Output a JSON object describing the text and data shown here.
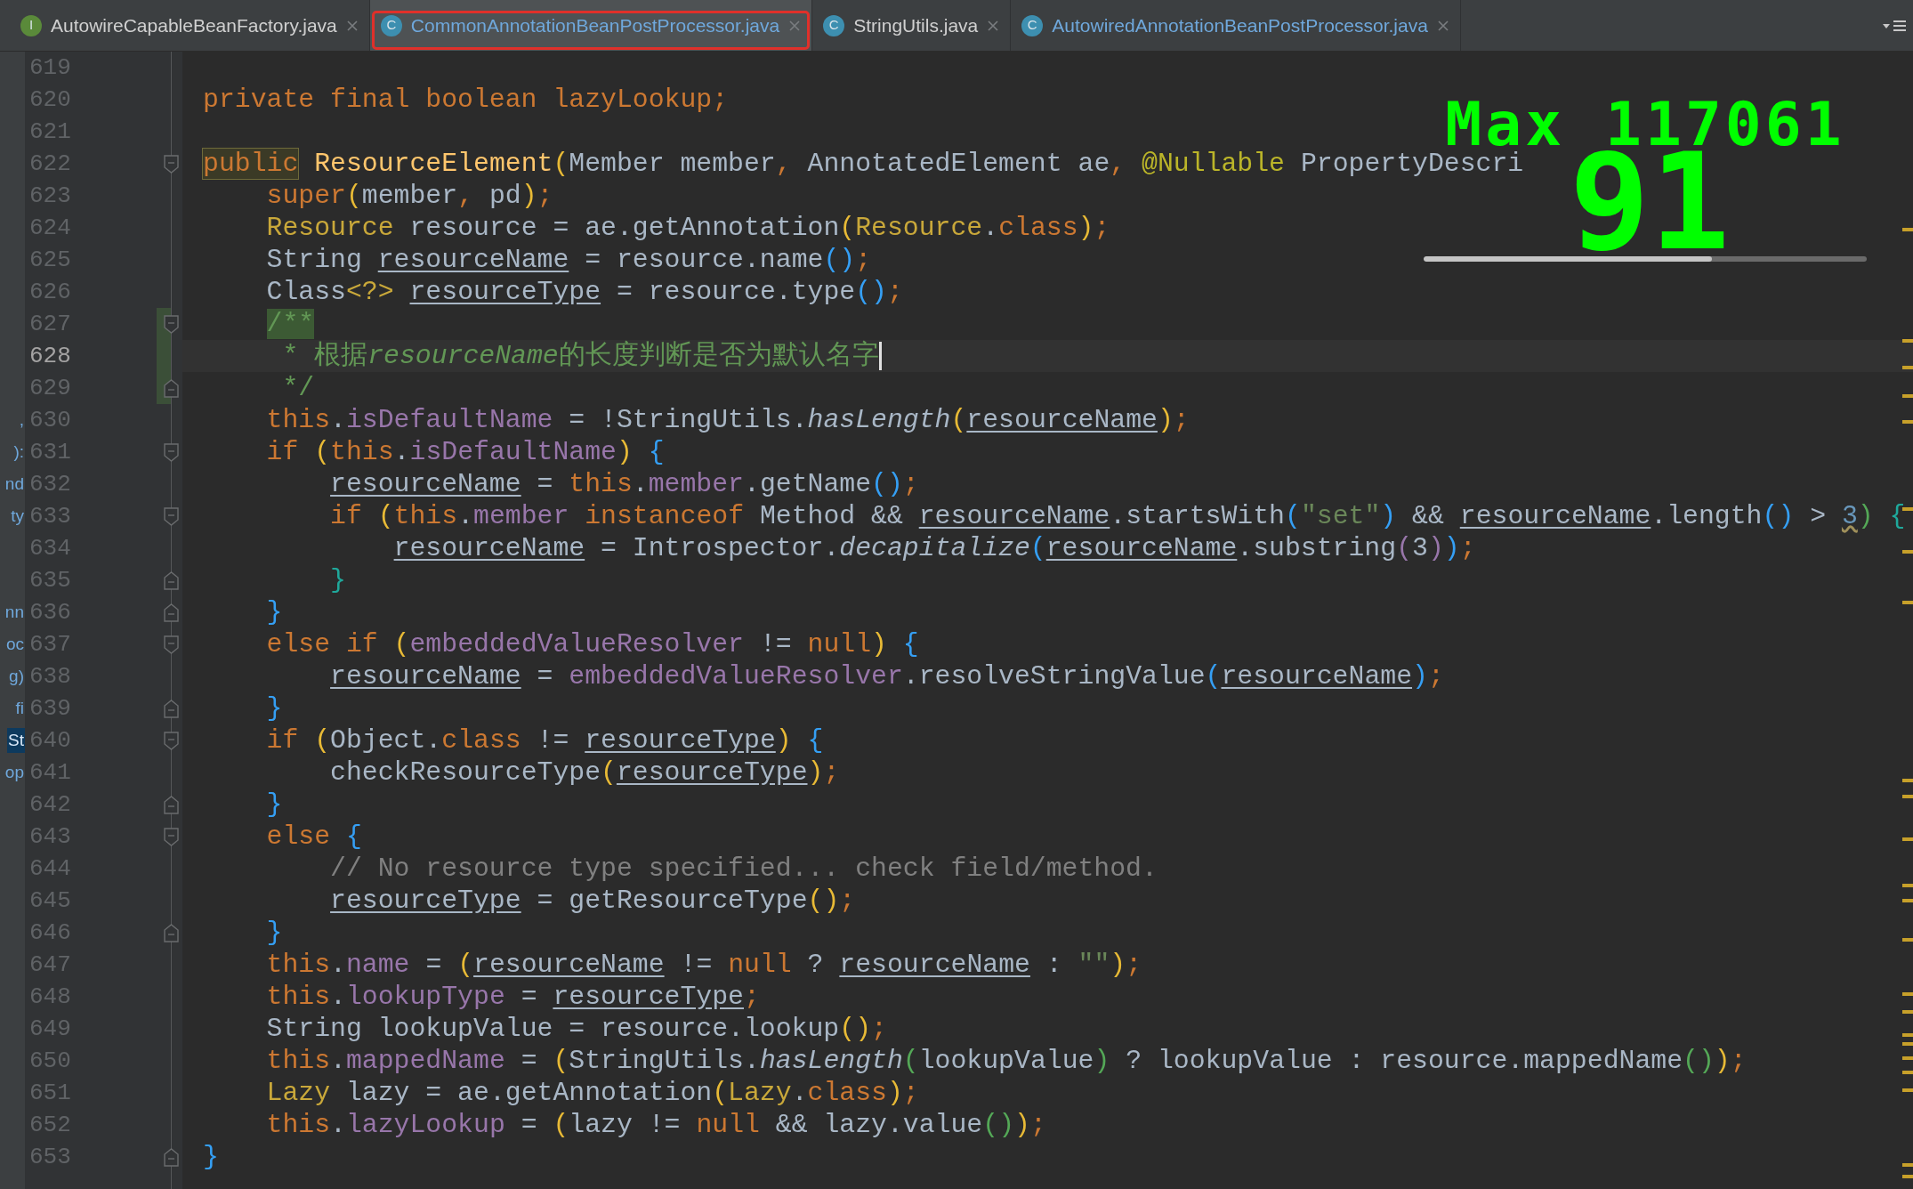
{
  "tabs": [
    {
      "icon_letter": "I",
      "color": "#5a8a3a",
      "label": "AutowireCapableBeanFactory.java",
      "selected": false,
      "modified": false,
      "outlined": false
    },
    {
      "icon_letter": "C",
      "color": "#3d8fb0",
      "label": "CommonAnnotationBeanPostProcessor.java",
      "selected": true,
      "modified": true,
      "outlined": true
    },
    {
      "icon_letter": "C",
      "color": "#3d8fb0",
      "label": "StringUtils.java",
      "selected": false,
      "modified": false,
      "outlined": false
    },
    {
      "icon_letter": "C",
      "color": "#3d8fb0",
      "label": "AutowiredAnnotationBeanPostProcessor.java",
      "selected": false,
      "modified": true,
      "outlined": false
    }
  ],
  "overlay": {
    "title": "Max 117061",
    "value": "91",
    "level": 0.65
  },
  "lines": [
    {
      "number": "619"
    },
    {
      "number": "620",
      "tokens": [
        {
          "kind": "kw",
          "text": "private final boolean lazyLookup;"
        }
      ]
    },
    {
      "number": "621"
    },
    {
      "number": "622",
      "fold": {
        "kind": "open"
      },
      "tokens": [
        {
          "kind": "kwmatch",
          "text": "public"
        },
        {
          "kind": "method",
          "text": " ResourceElement"
        },
        {
          "kind": "b1",
          "text": "("
        },
        {
          "kind": "plain",
          "text": "Member member"
        },
        {
          "kind": "kw",
          "text": ", "
        },
        {
          "kind": "plain",
          "text": "AnnotatedElement ae"
        },
        {
          "kind": "kw",
          "text": ", "
        },
        {
          "kind": "ann",
          "text": "@Nullable"
        },
        {
          "kind": "plain",
          "text": " PropertyDescri"
        }
      ]
    },
    {
      "number": "623",
      "tokens": [
        {
          "kind": "kw",
          "text": "    super"
        },
        {
          "kind": "b1",
          "text": "("
        },
        {
          "kind": "plain",
          "text": "member"
        },
        {
          "kind": "kw",
          "text": ", "
        },
        {
          "kind": "plain",
          "text": "pd"
        },
        {
          "kind": "b1",
          "text": ")"
        },
        {
          "kind": "kw",
          "text": ";"
        }
      ]
    },
    {
      "number": "624",
      "tokens": [
        {
          "kind": "type",
          "text": "    Resource"
        },
        {
          "kind": "plain",
          "text": " resource = ae.getAnnotation"
        },
        {
          "kind": "b1",
          "text": "("
        },
        {
          "kind": "type",
          "text": "Resource"
        },
        {
          "kind": "plain",
          "text": "."
        },
        {
          "kind": "kw",
          "text": "class"
        },
        {
          "kind": "b1",
          "text": ")"
        },
        {
          "kind": "kw",
          "text": ";"
        }
      ]
    },
    {
      "number": "625",
      "tokens": [
        {
          "kind": "plain",
          "text": "    String "
        },
        {
          "kind": "var",
          "text": "resourceName"
        },
        {
          "kind": "plain",
          "text": " = resource.name"
        },
        {
          "kind": "b3",
          "text": "()"
        },
        {
          "kind": "kw",
          "text": ";"
        }
      ]
    },
    {
      "number": "626",
      "tokens": [
        {
          "kind": "plain",
          "text": "    Class"
        },
        {
          "kind": "type",
          "text": "<?>"
        },
        {
          "kind": "var",
          "text": " resourceType"
        },
        {
          "kind": "plain",
          "text": " = resource.type"
        },
        {
          "kind": "b3",
          "text": "()"
        },
        {
          "kind": "kw",
          "text": ";"
        }
      ]
    },
    {
      "number": "627",
      "fold": {
        "kind": "open"
      },
      "changed": true,
      "tokens": [
        {
          "kind": "docmatch",
          "text": "    /**"
        }
      ]
    },
    {
      "number": "628",
      "changed": true,
      "current": true,
      "caret": true,
      "tokens": [
        {
          "kind": "doc",
          "text": "     * 根据"
        },
        {
          "kind": "docvar",
          "text": "resourceName"
        },
        {
          "kind": "doc",
          "text": "的长度判断是否为默认名字"
        }
      ]
    },
    {
      "number": "629",
      "fold": {
        "kind": "close"
      },
      "changed": true,
      "tokens": [
        {
          "kind": "doc",
          "text": "     */"
        }
      ]
    },
    {
      "number": "630",
      "side_text": ",",
      "side_selected": false,
      "tokens": [
        {
          "kind": "kw",
          "text": "    this"
        },
        {
          "kind": "plain",
          "text": "."
        },
        {
          "kind": "field",
          "text": "isDefaultName"
        },
        {
          "kind": "plain",
          "text": " = !StringUtils."
        },
        {
          "kind": "static",
          "text": "hasLength"
        },
        {
          "kind": "b1",
          "text": "("
        },
        {
          "kind": "var",
          "text": "resourceName"
        },
        {
          "kind": "b1",
          "text": ")"
        },
        {
          "kind": "kw",
          "text": ";"
        }
      ]
    },
    {
      "number": "631",
      "side_text": "):",
      "side_selected": false,
      "fold": {
        "kind": "open"
      },
      "tokens": [
        {
          "kind": "kw",
          "text": "    if "
        },
        {
          "kind": "b1",
          "text": "("
        },
        {
          "kind": "kw",
          "text": "this"
        },
        {
          "kind": "plain",
          "text": "."
        },
        {
          "kind": "field",
          "text": "isDefaultName"
        },
        {
          "kind": "b1",
          "text": ")"
        },
        {
          "kind": "b3",
          "text": " {"
        }
      ]
    },
    {
      "number": "632",
      "side_text": "nd",
      "side_selected": false,
      "tokens": [
        {
          "kind": "var",
          "text": "        resourceName"
        },
        {
          "kind": "plain",
          "text": " = "
        },
        {
          "kind": "kw",
          "text": "this"
        },
        {
          "kind": "plain",
          "text": "."
        },
        {
          "kind": "field",
          "text": "member"
        },
        {
          "kind": "plain",
          "text": ".getName"
        },
        {
          "kind": "b3",
          "text": "()"
        },
        {
          "kind": "kw",
          "text": ";"
        }
      ]
    },
    {
      "number": "633",
      "side_text": "ty",
      "side_selected": false,
      "fold": {
        "kind": "open"
      },
      "tokens": [
        {
          "kind": "kw",
          "text": "        if "
        },
        {
          "kind": "b1",
          "text": "("
        },
        {
          "kind": "kw",
          "text": "this"
        },
        {
          "kind": "plain",
          "text": "."
        },
        {
          "kind": "field",
          "text": "member"
        },
        {
          "kind": "kw",
          "text": " instanceof "
        },
        {
          "kind": "plain",
          "text": "Method && "
        },
        {
          "kind": "var",
          "text": "resourceName"
        },
        {
          "kind": "plain",
          "text": ".startsWith"
        },
        {
          "kind": "b3",
          "text": "("
        },
        {
          "kind": "str",
          "text": "\"set\""
        },
        {
          "kind": "b3",
          "text": ")"
        },
        {
          "kind": "plain",
          "text": " && "
        },
        {
          "kind": "var",
          "text": "resourceName"
        },
        {
          "kind": "plain",
          "text": ".length"
        },
        {
          "kind": "b3",
          "text": "()"
        },
        {
          "kind": "plain",
          "text": " > "
        },
        {
          "kind": "num",
          "text": "3"
        },
        {
          "kind": "b2",
          "text": ")"
        },
        {
          "kind": "b4",
          "text": " {"
        }
      ]
    },
    {
      "number": "634",
      "tokens": [
        {
          "kind": "var",
          "text": "            resourceName"
        },
        {
          "kind": "plain",
          "text": " = Introspector."
        },
        {
          "kind": "static",
          "text": "decapitalize"
        },
        {
          "kind": "b3",
          "text": "("
        },
        {
          "kind": "var",
          "text": "resourceName"
        },
        {
          "kind": "plain",
          "text": ".substring"
        },
        {
          "kind": "field",
          "text": "("
        },
        {
          "kind": "plain",
          "text": "3"
        },
        {
          "kind": "field",
          "text": ")"
        },
        {
          "kind": "b3",
          "text": ")"
        },
        {
          "kind": "kw",
          "text": ";"
        }
      ]
    },
    {
      "number": "635",
      "fold": {
        "kind": "close"
      },
      "tokens": [
        {
          "kind": "b4",
          "text": "        }"
        }
      ]
    },
    {
      "number": "636",
      "side_text": "nn",
      "side_selected": false,
      "fold": {
        "kind": "close"
      },
      "tokens": [
        {
          "kind": "b3",
          "text": "    }"
        }
      ]
    },
    {
      "number": "637",
      "side_text": "oc",
      "side_selected": false,
      "fold": {
        "kind": "open"
      },
      "tokens": [
        {
          "kind": "kw",
          "text": "    else if "
        },
        {
          "kind": "b1",
          "text": "("
        },
        {
          "kind": "field",
          "text": "embeddedValueResolver"
        },
        {
          "kind": "plain",
          "text": " != "
        },
        {
          "kind": "kw",
          "text": "null"
        },
        {
          "kind": "b1",
          "text": ")"
        },
        {
          "kind": "b3",
          "text": " {"
        }
      ]
    },
    {
      "number": "638",
      "side_text": "g)",
      "side_selected": false,
      "tokens": [
        {
          "kind": "var",
          "text": "        resourceName"
        },
        {
          "kind": "plain",
          "text": " = "
        },
        {
          "kind": "field",
          "text": "embeddedValueResolver"
        },
        {
          "kind": "plain",
          "text": ".resolveStringValue"
        },
        {
          "kind": "b3",
          "text": "("
        },
        {
          "kind": "var",
          "text": "resourceName"
        },
        {
          "kind": "b3",
          "text": ")"
        },
        {
          "kind": "kw",
          "text": ";"
        }
      ]
    },
    {
      "number": "639",
      "side_text": "fi",
      "side_selected": false,
      "fold": {
        "kind": "close"
      },
      "tokens": [
        {
          "kind": "b3",
          "text": "    }"
        }
      ]
    },
    {
      "number": "640",
      "side_text": "St",
      "side_selected": true,
      "fold": {
        "kind": "open"
      },
      "tokens": [
        {
          "kind": "kw",
          "text": "    if "
        },
        {
          "kind": "b1",
          "text": "("
        },
        {
          "kind": "plain",
          "text": "Object."
        },
        {
          "kind": "kw",
          "text": "class"
        },
        {
          "kind": "plain",
          "text": " != "
        },
        {
          "kind": "var",
          "text": "resourceType"
        },
        {
          "kind": "b1",
          "text": ")"
        },
        {
          "kind": "b3",
          "text": " {"
        }
      ]
    },
    {
      "number": "641",
      "side_text": "op",
      "side_selected": false,
      "tokens": [
        {
          "kind": "plain",
          "text": "        checkResourceType"
        },
        {
          "kind": "b1",
          "text": "("
        },
        {
          "kind": "var",
          "text": "resourceType"
        },
        {
          "kind": "b1",
          "text": ")"
        },
        {
          "kind": "kw",
          "text": ";"
        }
      ]
    },
    {
      "number": "642",
      "fold": {
        "kind": "close"
      },
      "tokens": [
        {
          "kind": "b3",
          "text": "    }"
        }
      ]
    },
    {
      "number": "643",
      "fold": {
        "kind": "open"
      },
      "tokens": [
        {
          "kind": "kw",
          "text": "    else"
        },
        {
          "kind": "b3",
          "text": " {"
        }
      ]
    },
    {
      "number": "644",
      "tokens": [
        {
          "kind": "cmt",
          "text": "        // No resource type specified... check field/method."
        }
      ]
    },
    {
      "number": "645",
      "tokens": [
        {
          "kind": "var",
          "text": "        resourceType"
        },
        {
          "kind": "plain",
          "text": " = getResourceType"
        },
        {
          "kind": "b1",
          "text": "()"
        },
        {
          "kind": "kw",
          "text": ";"
        }
      ]
    },
    {
      "number": "646",
      "fold": {
        "kind": "close"
      },
      "tokens": [
        {
          "kind": "b3",
          "text": "    }"
        }
      ]
    },
    {
      "number": "647",
      "tokens": [
        {
          "kind": "kw",
          "text": "    this"
        },
        {
          "kind": "plain",
          "text": "."
        },
        {
          "kind": "field",
          "text": "name"
        },
        {
          "kind": "plain",
          "text": " = "
        },
        {
          "kind": "b1",
          "text": "("
        },
        {
          "kind": "var",
          "text": "resourceName"
        },
        {
          "kind": "plain",
          "text": " != "
        },
        {
          "kind": "kw",
          "text": "null"
        },
        {
          "kind": "plain",
          "text": " ? "
        },
        {
          "kind": "var",
          "text": "resourceName"
        },
        {
          "kind": "plain",
          "text": " : "
        },
        {
          "kind": "str",
          "text": "\"\""
        },
        {
          "kind": "b1",
          "text": ")"
        },
        {
          "kind": "kw",
          "text": ";"
        }
      ]
    },
    {
      "number": "648",
      "tokens": [
        {
          "kind": "kw",
          "text": "    this"
        },
        {
          "kind": "plain",
          "text": "."
        },
        {
          "kind": "field",
          "text": "lookupType"
        },
        {
          "kind": "plain",
          "text": " = "
        },
        {
          "kind": "var",
          "text": "resourceType"
        },
        {
          "kind": "kw",
          "text": ";"
        }
      ]
    },
    {
      "number": "649",
      "tokens": [
        {
          "kind": "plain",
          "text": "    String lookupValue = resource.lookup"
        },
        {
          "kind": "b1",
          "text": "()"
        },
        {
          "kind": "kw",
          "text": ";"
        }
      ]
    },
    {
      "number": "650",
      "tokens": [
        {
          "kind": "kw",
          "text": "    this"
        },
        {
          "kind": "plain",
          "text": "."
        },
        {
          "kind": "field",
          "text": "mappedName"
        },
        {
          "kind": "plain",
          "text": " = "
        },
        {
          "kind": "b1",
          "text": "("
        },
        {
          "kind": "plain",
          "text": "StringUtils."
        },
        {
          "kind": "static",
          "text": "hasLength"
        },
        {
          "kind": "b2",
          "text": "("
        },
        {
          "kind": "plain",
          "text": "lookupValue"
        },
        {
          "kind": "b2",
          "text": ")"
        },
        {
          "kind": "plain",
          "text": " ? lookupValue : resource.mappedName"
        },
        {
          "kind": "b2",
          "text": "()"
        },
        {
          "kind": "b1",
          "text": ")"
        },
        {
          "kind": "kw",
          "text": ";"
        }
      ]
    },
    {
      "number": "651",
      "tokens": [
        {
          "kind": "type",
          "text": "    Lazy"
        },
        {
          "kind": "plain",
          "text": " lazy = ae.getAnnotation"
        },
        {
          "kind": "b1",
          "text": "("
        },
        {
          "kind": "type",
          "text": "Lazy"
        },
        {
          "kind": "plain",
          "text": "."
        },
        {
          "kind": "kw",
          "text": "class"
        },
        {
          "kind": "b1",
          "text": ")"
        },
        {
          "kind": "kw",
          "text": ";"
        }
      ]
    },
    {
      "number": "652",
      "tokens": [
        {
          "kind": "kw",
          "text": "    this"
        },
        {
          "kind": "plain",
          "text": "."
        },
        {
          "kind": "field",
          "text": "lazyLookup"
        },
        {
          "kind": "plain",
          "text": " = "
        },
        {
          "kind": "b1",
          "text": "("
        },
        {
          "kind": "plain",
          "text": "lazy != "
        },
        {
          "kind": "kw",
          "text": "null"
        },
        {
          "kind": "plain",
          "text": " && lazy.value"
        },
        {
          "kind": "b2",
          "text": "()"
        },
        {
          "kind": "b1",
          "text": ")"
        },
        {
          "kind": "kw",
          "text": ";"
        }
      ]
    },
    {
      "number": "653",
      "fold": {
        "kind": "close"
      },
      "tokens": [
        {
          "kind": "b3",
          "text": "}"
        }
      ]
    }
  ]
}
